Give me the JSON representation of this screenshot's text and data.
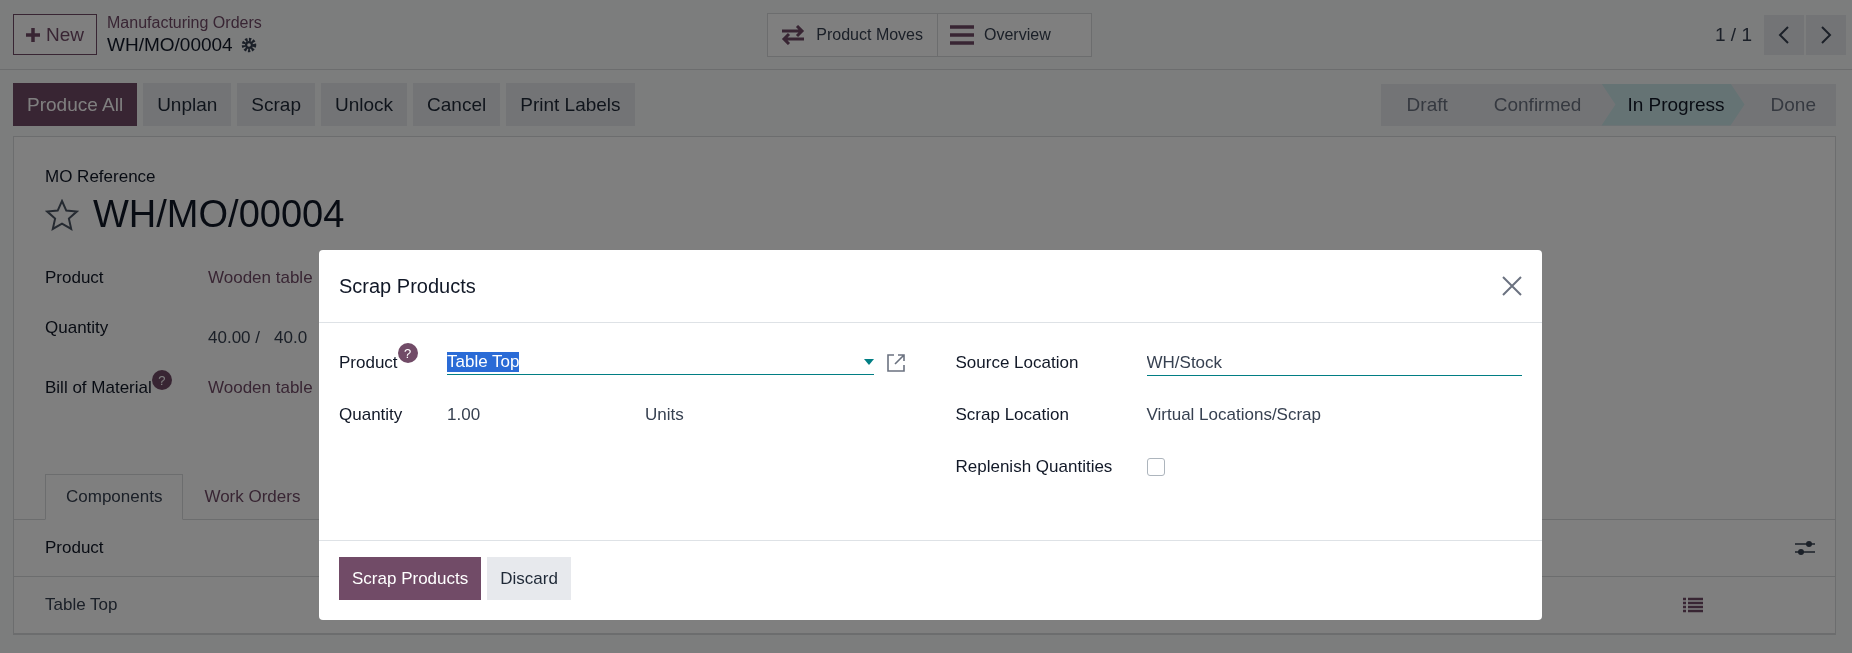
{
  "header": {
    "new_button": "New",
    "breadcrumb": "Manufacturing Orders",
    "record": "WH/MO/00004",
    "smart_buttons": [
      {
        "label": "Product Moves",
        "kind": "moves"
      },
      {
        "label": "Overview",
        "kind": "overview"
      }
    ],
    "pager": "1 / 1"
  },
  "actions": [
    {
      "label": "Produce All",
      "primary": true
    },
    {
      "label": "Unplan",
      "primary": false
    },
    {
      "label": "Scrap",
      "primary": false
    },
    {
      "label": "Unlock",
      "primary": false
    },
    {
      "label": "Cancel",
      "primary": false
    },
    {
      "label": "Print Labels",
      "primary": false
    }
  ],
  "stages": [
    {
      "label": "Draft",
      "selected": false
    },
    {
      "label": "Confirmed",
      "selected": false
    },
    {
      "label": "In Progress",
      "selected": true
    },
    {
      "label": "Done",
      "selected": false
    }
  ],
  "form": {
    "reference_label": "MO Reference",
    "title": "WH/MO/00004",
    "starred": false,
    "fields": [
      {
        "label": "Product",
        "values": [
          "Wooden table"
        ]
      },
      {
        "label": "Quantity",
        "values": [
          "40.00 /",
          "40.0"
        ]
      },
      {
        "label": "Bill of Material",
        "help": "?",
        "values": [
          "Wooden table"
        ]
      }
    ],
    "tabs": [
      {
        "label": "Components",
        "selected": true
      },
      {
        "label": "Work Orders",
        "selected": false
      }
    ],
    "table": {
      "columns": [
        "Product"
      ],
      "rows": [
        {
          "product": "Table Top"
        }
      ]
    }
  },
  "dialog": {
    "title": "Scrap Products",
    "left_fields": [
      {
        "label": "Product",
        "help": "?",
        "kind": "select",
        "value": "Table Top"
      },
      {
        "label": "Quantity",
        "kind": "quantity",
        "value": "1.00",
        "unit": "Units"
      }
    ],
    "right_fields": [
      {
        "label": "Source Location",
        "kind": "input",
        "value": "WH/Stock"
      },
      {
        "label": "Scrap Location",
        "kind": "text",
        "value": "Virtual Locations/Scrap"
      },
      {
        "label": "Replenish Quantities",
        "kind": "checkbox",
        "checked": false
      }
    ],
    "buttons": [
      {
        "label": "Scrap Products",
        "primary": true
      },
      {
        "label": "Discard",
        "primary": false
      }
    ]
  }
}
